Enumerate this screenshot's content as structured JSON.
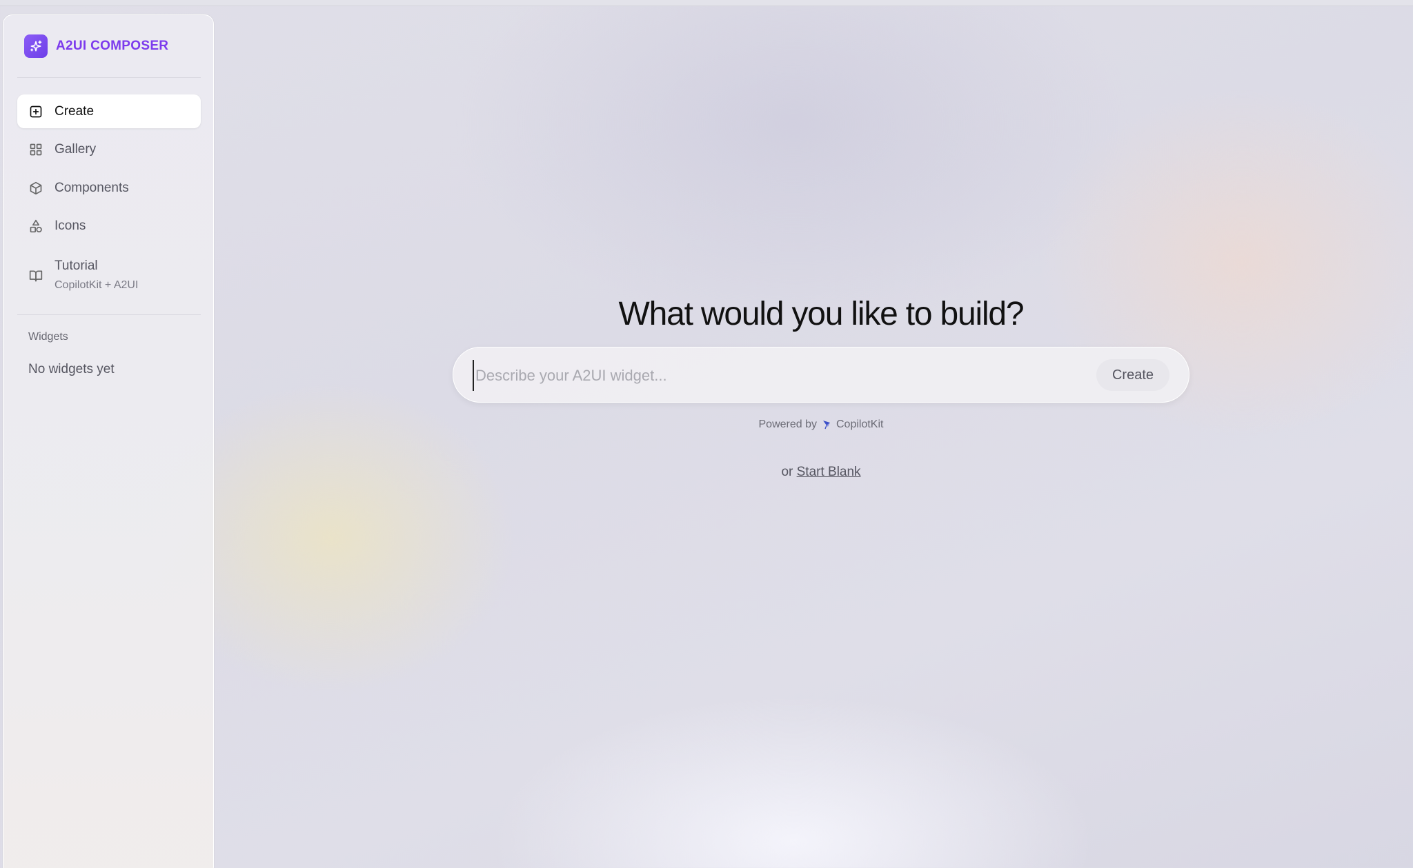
{
  "sidebar": {
    "brand": {
      "name": "A2UI COMPOSER",
      "icon": "sparkles-icon",
      "color": "#7c3aed"
    },
    "items": [
      {
        "label": "Create",
        "icon": "plus-square-icon",
        "active": true
      },
      {
        "label": "Gallery",
        "icon": "grid-icon"
      },
      {
        "label": "Components",
        "icon": "cube-icon"
      },
      {
        "label": "Icons",
        "icon": "shapes-icon"
      },
      {
        "label": "Tutorial",
        "sublabel": "CopilotKit + A2UI",
        "icon": "book-open-icon"
      }
    ],
    "widgets": {
      "title": "Widgets",
      "empty": "No widgets yet"
    }
  },
  "main": {
    "headline": "What would you like to build?",
    "prompt": {
      "placeholder": "Describe your A2UI widget...",
      "value": ""
    },
    "create_label": "Create",
    "powered_by": {
      "prefix": "Powered by",
      "brand": "CopilotKit",
      "icon": "kite-icon"
    },
    "alt": {
      "prefix": "or",
      "link": "Start Blank"
    }
  }
}
